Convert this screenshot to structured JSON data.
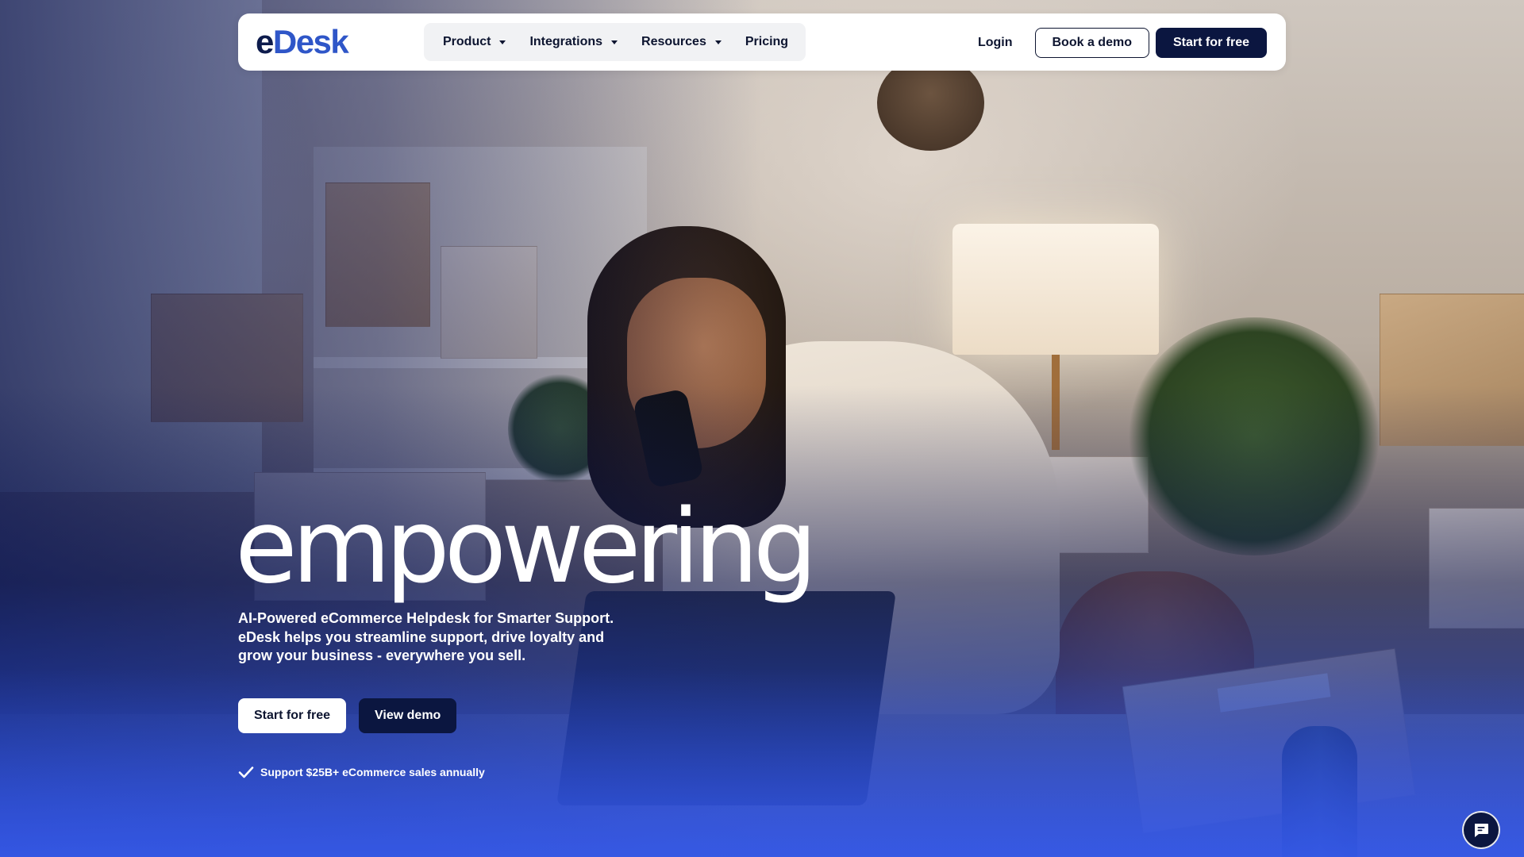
{
  "brand": {
    "logo_text": "eDesk",
    "colors": {
      "navy": "#0b1640",
      "blue": "#2f56c8",
      "hero_gradient": "#2c4edc"
    }
  },
  "nav": {
    "menu": [
      {
        "label": "Product",
        "has_dropdown": true
      },
      {
        "label": "Integrations",
        "has_dropdown": true
      },
      {
        "label": "Resources",
        "has_dropdown": true
      },
      {
        "label": "Pricing",
        "has_dropdown": false
      }
    ],
    "login_label": "Login",
    "book_demo_label": "Book a demo",
    "start_free_label": "Start for free"
  },
  "hero": {
    "headline": "empowering",
    "subtitle": "AI-Powered eCommerce Helpdesk for Smarter Support. eDesk helps you streamline support, drive loyalty and grow your business - everywhere you sell.",
    "primary_cta": "Start for free",
    "secondary_cta": "View demo",
    "proof_text": "Support $25B+ eCommerce sales annually",
    "proof_icon": "check-icon"
  },
  "chat": {
    "icon": "chat-icon"
  }
}
